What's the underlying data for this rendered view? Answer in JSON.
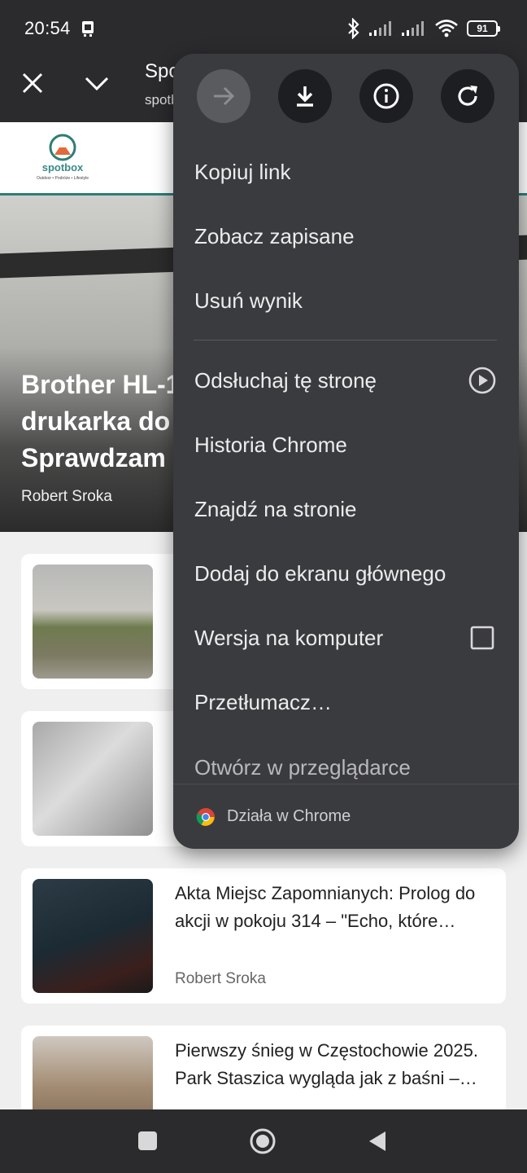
{
  "status_bar": {
    "time": "20:54",
    "battery": "91",
    "icons": [
      "sim-icon",
      "bluetooth-icon",
      "signal-icon",
      "signal-icon",
      "wifi-icon",
      "battery-icon"
    ]
  },
  "toolbar": {
    "title": "Spotbox",
    "url": "spotbox.pl",
    "icons": [
      "close-icon",
      "chevron-down-icon"
    ]
  },
  "page": {
    "logo_text": "spotbox",
    "logo_sub": "Outdoor • Podróże • Lifestyle",
    "hero": {
      "title": "Brother HL-1\ndrukarka do\nSprawdzam",
      "author": "Robert Sroka"
    },
    "cards": [
      {
        "title": "",
        "author": ""
      },
      {
        "title": "",
        "author": ""
      },
      {
        "title": "Akta Miejsc Zapomnianych: Prolog do akcji w pokoju 314 – \"Echo, które…",
        "author": "Robert Sroka"
      },
      {
        "title": "Pierwszy śnieg w Częstochowie 2025. Park Staszica wygląda jak z baśni –…",
        "author": ""
      }
    ]
  },
  "menu": {
    "top_icons": [
      "forward-icon",
      "download-icon",
      "info-icon",
      "refresh-icon"
    ],
    "items": [
      {
        "label": "Kopiuj link"
      },
      {
        "label": "Zobacz zapisane"
      },
      {
        "label": "Usuń wynik"
      },
      {
        "label": "Odsłuchaj tę stronę",
        "trailing": "play-circle-icon"
      },
      {
        "label": "Historia Chrome"
      },
      {
        "label": "Znajdź na stronie"
      },
      {
        "label": "Dodaj do ekranu głównego"
      },
      {
        "label": "Wersja na komputer",
        "trailing": "checkbox-icon",
        "checked": false
      },
      {
        "label": "Przetłumacz…"
      },
      {
        "label": "Otwórz w przeglądarce"
      }
    ],
    "footer": "Działa w Chrome"
  },
  "nav_bar": {
    "icons": [
      "recents-icon",
      "home-icon",
      "back-icon"
    ]
  },
  "colors": {
    "system_bar": "#2b2b2e",
    "menu_bg": "#3a3b3f",
    "menu_text": "#ececec",
    "accent_teal": "#2e7d76"
  }
}
